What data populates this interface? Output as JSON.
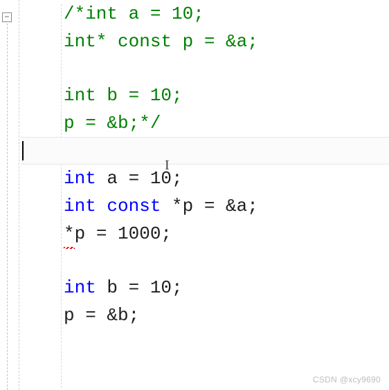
{
  "fold": {
    "symbol": "−"
  },
  "comment": {
    "l1": "/*int a = 10;",
    "l2": "int* const p = &a;",
    "l3": "int b = 10;",
    "l4": "p = &b;*/"
  },
  "code": {
    "kw_int": "int",
    "kw_const": "const",
    "decl_a": " a = 10;",
    "decl_p_part": " *p = &a;",
    "star": "*",
    "assign_p": "p = 1000;",
    "decl_b": " b = 10;",
    "assign_pb": "p = &b;"
  },
  "ibeam_glyph": "I",
  "watermark": "CSDN @xcy9690"
}
